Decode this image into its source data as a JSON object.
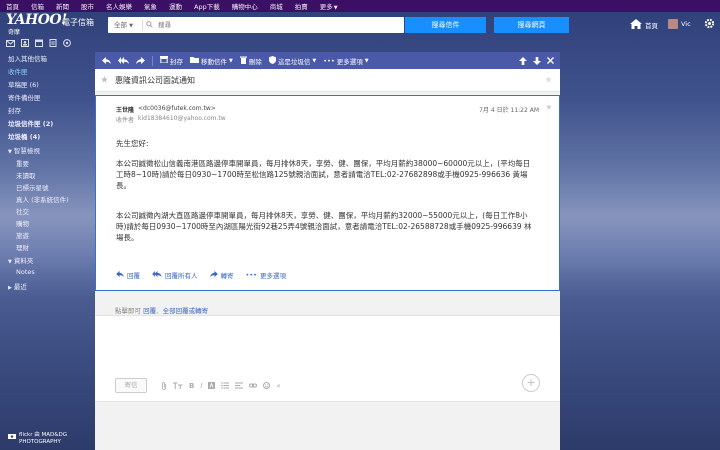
{
  "topnav": {
    "items": [
      "首頁",
      "信箱",
      "新聞",
      "股市",
      "名人娛樂",
      "氣象",
      "運動",
      "App下載",
      "購物中心",
      "商城",
      "拍賣",
      "更多"
    ]
  },
  "brand": {
    "logo": "YAHOO!",
    "logo_sub": "奇摩",
    "product": "電子信箱"
  },
  "search": {
    "scope": "全部",
    "placeholder": "搜尋",
    "search_mail_label": "搜尋信件",
    "search_web_label": "搜尋網頁"
  },
  "header": {
    "home_label": "首頁",
    "user_name": "Vic"
  },
  "sidebar": {
    "items": [
      "加入其他信箱",
      "收件匣",
      "草稿匣 (6)",
      "寄件備份匣",
      "封存",
      "垃圾信件匣 (2)",
      "垃圾桶 (4)",
      "智慧檢視",
      "重要",
      "未讀取",
      "已標示星號",
      "真人 (非系統信件)",
      "社交",
      "購物",
      "旅遊",
      "理財",
      "資料夾",
      "Notes",
      "最近"
    ],
    "flickr_line1": "flickr 由 MAD&DG",
    "flickr_line2": "PHOTOGRAPHY"
  },
  "toolbar": {
    "archive": "封存",
    "move": "移動信件",
    "delete": "刪除",
    "spam": "這是垃圾信",
    "more": "更多選項"
  },
  "message": {
    "subject": "惠隆資訊公司面試通知",
    "from_name": "王世隆",
    "from_email": "<dc0036@futek.com.tw>",
    "to_label": "收件者",
    "to_email": "kid18384610@yahoo.com.tw",
    "date": "7月 4 日於 11:22 AM",
    "greeting": "先生您好:",
    "para1": "本公司誠徵松山信義南港區路邊停車開單員，每月排休8天，享勞、健、團保，平均月薪約38000~60000元以上，(平均每日工時8~10時)請於每日0930~1700時至松信路125號親洽面試，意者請電洽TEL:02-27682898或手機0925-996636 黃場長。",
    "para2": "本公司誠徵內湖大直區路邊停車開單員，每月排休8天，享勞、健、團保，平均月薪約32000~55000元以上，(每日工作8小時)請於每日0930~1700時至內湖區陽光街92巷25弄4號親洽面試，意者請電洽TEL:02-26588728或手機0925-996639 林場長。",
    "reply": "回覆",
    "reply_all": "回覆所有人",
    "forward": "轉寄",
    "more": "更多選項"
  },
  "quick_reply": {
    "prefix": "點擊即可",
    "reply": "回覆",
    "sep": "、",
    "reply_all_forward": "全部回覆或轉寄"
  },
  "compose": {
    "send": "寄信"
  }
}
